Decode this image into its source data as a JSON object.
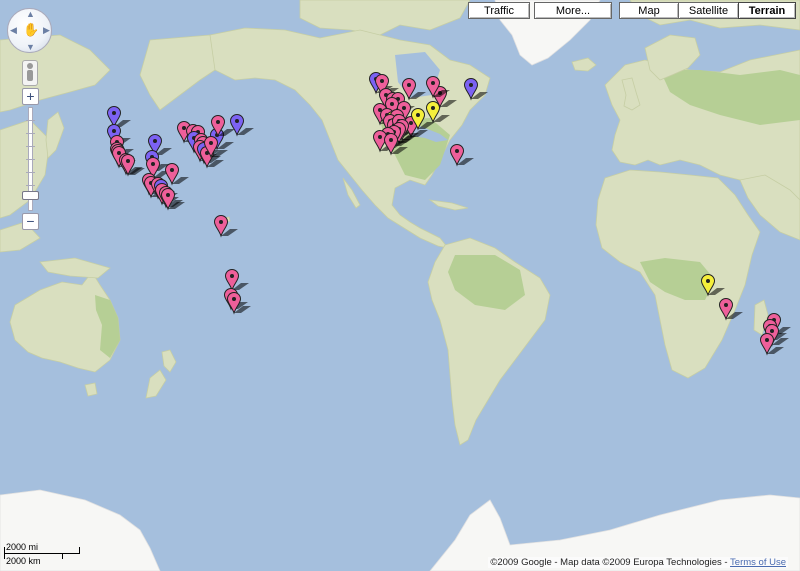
{
  "map_types": [
    {
      "label": "Traffic",
      "active": false
    },
    {
      "label": "More...",
      "active": false
    },
    {
      "label": "Map",
      "active": false
    },
    {
      "label": "Satellite",
      "active": false
    },
    {
      "label": "Terrain",
      "active": true
    }
  ],
  "controls": {
    "zoom_in": "+",
    "zoom_out": "−",
    "zoom_level": 2
  },
  "scale": {
    "miles": "2000 mi",
    "km": "2000 km"
  },
  "footer": {
    "copyright": "©2009 Google - Map data ©2009 Europa Technologies - ",
    "terms": "Terms of Use"
  },
  "colors": {
    "pink": "#ee5f9a",
    "blue": "#7c62f3",
    "yellow": "#f5ef3b",
    "water": "#a5bfdd",
    "land": "#d9dfbf"
  },
  "markers": [
    {
      "lat": 49.5,
      "lon": -123.5,
      "color": "blue"
    },
    {
      "lat": 44.0,
      "lon": -123.8,
      "color": "blue"
    },
    {
      "lat": 40.2,
      "lon": -122.3,
      "color": "pink"
    },
    {
      "lat": 37.8,
      "lon": -122.4,
      "color": "pink"
    },
    {
      "lat": 37.3,
      "lon": -121.9,
      "color": "pink"
    },
    {
      "lat": 36.6,
      "lon": -121.3,
      "color": "pink"
    },
    {
      "lat": 34.0,
      "lon": -118.3,
      "color": "pink"
    },
    {
      "lat": 33.5,
      "lon": -117.4,
      "color": "pink"
    },
    {
      "lat": 40.5,
      "lon": -105.2,
      "color": "blue"
    },
    {
      "lat": 35.1,
      "lon": -106.6,
      "color": "blue"
    },
    {
      "lat": 32.3,
      "lon": -106.0,
      "color": "pink"
    },
    {
      "lat": 30.0,
      "lon": -97.8,
      "color": "pink"
    },
    {
      "lat": 26.0,
      "lon": -108.0,
      "color": "pink"
    },
    {
      "lat": 25.0,
      "lon": -107.0,
      "color": "pink"
    },
    {
      "lat": 24.5,
      "lon": -104.0,
      "color": "pink"
    },
    {
      "lat": 23.5,
      "lon": -102.5,
      "color": "blue"
    },
    {
      "lat": 22.0,
      "lon": -102.0,
      "color": "pink"
    },
    {
      "lat": 20.5,
      "lon": -100.5,
      "color": "pink"
    },
    {
      "lat": 19.8,
      "lon": -99.2,
      "color": "pink"
    },
    {
      "lat": 45.0,
      "lon": -92.0,
      "color": "pink"
    },
    {
      "lat": 44.0,
      "lon": -88.0,
      "color": "pink"
    },
    {
      "lat": 43.5,
      "lon": -86.0,
      "color": "pink"
    },
    {
      "lat": 41.5,
      "lon": -87.5,
      "color": "blue"
    },
    {
      "lat": 41.0,
      "lon": -84.5,
      "color": "pink"
    },
    {
      "lat": 40.0,
      "lon": -83.5,
      "color": "pink"
    },
    {
      "lat": 38.5,
      "lon": -85.0,
      "color": "pink"
    },
    {
      "lat": 38.0,
      "lon": -83.0,
      "color": "blue"
    },
    {
      "lat": 36.5,
      "lon": -82.0,
      "color": "pink"
    },
    {
      "lat": 42.5,
      "lon": -77.5,
      "color": "blue"
    },
    {
      "lat": 40.0,
      "lon": -80.0,
      "color": "pink"
    },
    {
      "lat": 46.8,
      "lon": -77.0,
      "color": "pink"
    },
    {
      "lat": 47.2,
      "lon": -68.5,
      "color": "blue"
    },
    {
      "lat": 8.0,
      "lon": -75.5,
      "color": "pink"
    },
    {
      "lat": -16.0,
      "lon": -70.5,
      "color": "pink"
    },
    {
      "lat": -24.0,
      "lon": -71.0,
      "color": "pink"
    },
    {
      "lat": -25.5,
      "lon": -69.5,
      "color": "pink"
    },
    {
      "lat": 58.5,
      "lon": -6.0,
      "color": "blue"
    },
    {
      "lat": 58.0,
      "lon": -3.0,
      "color": "pink"
    },
    {
      "lat": 57.0,
      "lon": 9.0,
      "color": "pink"
    },
    {
      "lat": 54.5,
      "lon": -1.5,
      "color": "pink"
    },
    {
      "lat": 53.5,
      "lon": 2.0,
      "color": "pink"
    },
    {
      "lat": 53.5,
      "lon": 4.0,
      "color": "pink"
    },
    {
      "lat": 52.0,
      "lon": 1.5,
      "color": "pink"
    },
    {
      "lat": 51.0,
      "lon": 7.0,
      "color": "pink"
    },
    {
      "lat": 50.5,
      "lon": -4.0,
      "color": "pink"
    },
    {
      "lat": 49.0,
      "lon": -1.0,
      "color": "pink"
    },
    {
      "lat": 48.0,
      "lon": 2.0,
      "color": "yellow"
    },
    {
      "lat": 48.5,
      "lon": 3.5,
      "color": "pink"
    },
    {
      "lat": 47.0,
      "lon": 0.5,
      "color": "pink"
    },
    {
      "lat": 46.0,
      "lon": 2.5,
      "color": "pink"
    },
    {
      "lat": 47.0,
      "lon": 4.5,
      "color": "pink"
    },
    {
      "lat": 46.5,
      "lon": 10.0,
      "color": "pink"
    },
    {
      "lat": 45.5,
      "lon": 6.0,
      "color": "pink"
    },
    {
      "lat": 44.5,
      "lon": 4.5,
      "color": "pink"
    },
    {
      "lat": 43.5,
      "lon": 2.5,
      "color": "pink"
    },
    {
      "lat": 43.0,
      "lon": -0.5,
      "color": "pink"
    },
    {
      "lat": 42.0,
      "lon": -4.0,
      "color": "pink"
    },
    {
      "lat": 41.0,
      "lon": 1.0,
      "color": "pink"
    },
    {
      "lat": 49.0,
      "lon": 13.0,
      "color": "yellow"
    },
    {
      "lat": 51.0,
      "lon": 20.0,
      "color": "yellow"
    },
    {
      "lat": 55.0,
      "lon": 23.0,
      "color": "pink"
    },
    {
      "lat": 57.5,
      "lon": 20.0,
      "color": "pink"
    },
    {
      "lat": 57.0,
      "lon": 37.0,
      "color": "blue"
    },
    {
      "lat": 37.0,
      "lon": 30.5,
      "color": "pink"
    },
    {
      "lat": -18.0,
      "lon": 143.5,
      "color": "yellow"
    },
    {
      "lat": -28.0,
      "lon": 151.5,
      "color": "pink"
    },
    {
      "lat": -34.0,
      "lon": 173.5,
      "color": "pink"
    },
    {
      "lat": -36.0,
      "lon": 171.5,
      "color": "pink"
    },
    {
      "lat": -38.0,
      "lon": 172.5,
      "color": "pink"
    },
    {
      "lat": -41.0,
      "lon": 170.0,
      "color": "pink"
    }
  ]
}
